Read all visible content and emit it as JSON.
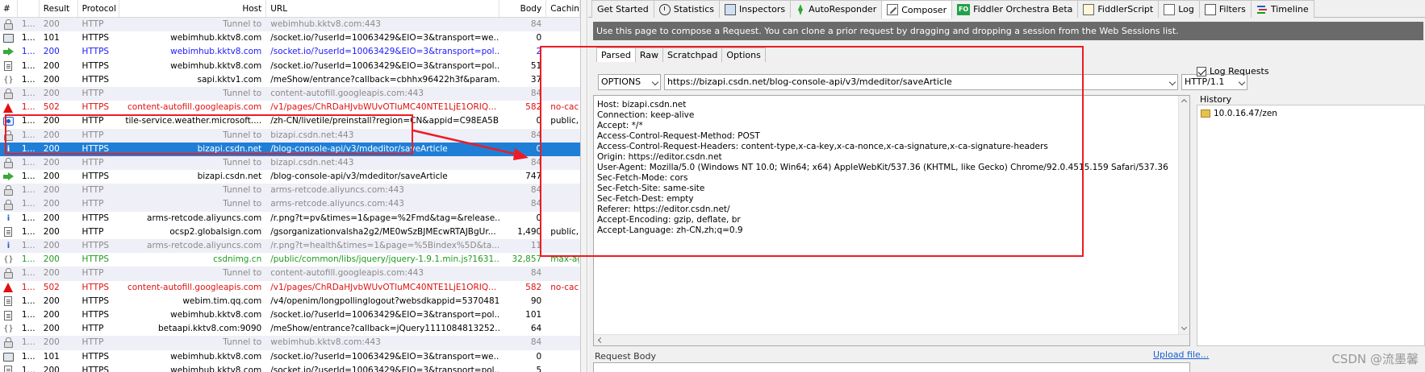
{
  "sessions": {
    "columns": [
      "#",
      "Result",
      "Protocol",
      "Host",
      "URL",
      "Body",
      "Caching"
    ],
    "rows": [
      {
        "icon": "lock",
        "style": "tunnel",
        "num": "1...",
        "result": "200",
        "protocol": "HTTP",
        "host": "Tunnel to",
        "url": "webimhub.kktv8.com:443",
        "body": "84",
        "caching": ""
      },
      {
        "icon": "socket",
        "style": "normal",
        "num": "1...",
        "result": "101",
        "protocol": "HTTPS",
        "host": "webimhub.kktv8.com",
        "url": "/socket.io/?userId=10063429&EIO=3&transport=we...",
        "body": "0",
        "caching": ""
      },
      {
        "icon": "arrow",
        "style": "blue",
        "num": "1...",
        "result": "200",
        "protocol": "HTTPS",
        "host": "webimhub.kktv8.com",
        "url": "/socket.io/?userId=10063429&EIO=3&transport=pol...",
        "body": "2",
        "caching": ""
      },
      {
        "icon": "doc",
        "style": "normal",
        "num": "1...",
        "result": "200",
        "protocol": "HTTPS",
        "host": "webimhub.kktv8.com",
        "url": "/socket.io/?userId=10063429&EIO=3&transport=pol...",
        "body": "51",
        "caching": ""
      },
      {
        "icon": "braces",
        "style": "normal",
        "num": "1...",
        "result": "200",
        "protocol": "HTTPS",
        "host": "sapi.kktv1.com",
        "url": "/meShow/entrance?callback=cbhhx96422h3f&param...",
        "body": "37",
        "caching": ""
      },
      {
        "icon": "lock",
        "style": "tunnel",
        "num": "1...",
        "result": "200",
        "protocol": "HTTP",
        "host": "Tunnel to",
        "url": "content-autofill.googleapis.com:443",
        "body": "84",
        "caching": ""
      },
      {
        "icon": "warn",
        "style": "red",
        "num": "1...",
        "result": "502",
        "protocol": "HTTPS",
        "host": "content-autofill.googleapis.com",
        "url": "/v1/pages/ChRDaHJvbWUvOTIuMC40NTE1LjE1ORIQ...",
        "body": "582",
        "caching": "no-cac..."
      },
      {
        "icon": "eye",
        "style": "normal",
        "num": "1...",
        "result": "200",
        "protocol": "HTTP",
        "host": "tile-service.weather.microsoft....",
        "url": "/zh-CN/livetile/preinstall?region=CN&appid=C98EA5B...",
        "body": "0",
        "caching": "public, ..."
      },
      {
        "icon": "lock",
        "style": "tunnel",
        "num": "1...",
        "result": "200",
        "protocol": "HTTP",
        "host": "Tunnel to",
        "url": "bizapi.csdn.net:443",
        "body": "84",
        "caching": ""
      },
      {
        "icon": "info",
        "style": "selected",
        "num": "1...",
        "result": "200",
        "protocol": "HTTPS",
        "host": "bizapi.csdn.net",
        "url": "/blog-console-api/v3/mdeditor/saveArticle",
        "body": "0",
        "caching": ""
      },
      {
        "icon": "lock",
        "style": "tunnel",
        "num": "1...",
        "result": "200",
        "protocol": "HTTP",
        "host": "Tunnel to",
        "url": "bizapi.csdn.net:443",
        "body": "84",
        "caching": ""
      },
      {
        "icon": "arrow",
        "style": "normal",
        "num": "1...",
        "result": "200",
        "protocol": "HTTPS",
        "host": "bizapi.csdn.net",
        "url": "/blog-console-api/v3/mdeditor/saveArticle",
        "body": "747",
        "caching": ""
      },
      {
        "icon": "lock",
        "style": "tunnel",
        "num": "1...",
        "result": "200",
        "protocol": "HTTP",
        "host": "Tunnel to",
        "url": "arms-retcode.aliyuncs.com:443",
        "body": "84",
        "caching": ""
      },
      {
        "icon": "lock",
        "style": "tunnel",
        "num": "1...",
        "result": "200",
        "protocol": "HTTP",
        "host": "Tunnel to",
        "url": "arms-retcode.aliyuncs.com:443",
        "body": "84",
        "caching": ""
      },
      {
        "icon": "info",
        "style": "normal",
        "num": "1...",
        "result": "200",
        "protocol": "HTTPS",
        "host": "arms-retcode.aliyuncs.com",
        "url": "/r.png?t=pv&times=1&page=%2Fmd&tag=&release...",
        "body": "0",
        "caching": ""
      },
      {
        "icon": "doc",
        "style": "normal",
        "num": "1...",
        "result": "200",
        "protocol": "HTTP",
        "host": "ocsp2.globalsign.com",
        "url": "/gsorganizationvalsha2g2/ME0wSzBJMEcwRTAJBgUr...",
        "body": "1,490",
        "caching": "public, ..."
      },
      {
        "icon": "info",
        "style": "tunnel",
        "num": "1...",
        "result": "200",
        "protocol": "HTTPS",
        "host": "arms-retcode.aliyuncs.com",
        "url": "/r.png?t=health&times=1&page=%5Bindex%5D&ta...",
        "body": "11",
        "caching": ""
      },
      {
        "icon": "braces",
        "style": "green",
        "num": "1...",
        "result": "200",
        "protocol": "HTTPS",
        "host": "csdnimg.cn",
        "url": "/public/common/libs/jquery/jquery-1.9.1.min.js?1631...",
        "body": "32,857",
        "caching": "max-ag..."
      },
      {
        "icon": "lock",
        "style": "tunnel",
        "num": "1...",
        "result": "200",
        "protocol": "HTTP",
        "host": "Tunnel to",
        "url": "content-autofill.googleapis.com:443",
        "body": "84",
        "caching": ""
      },
      {
        "icon": "warn",
        "style": "red",
        "num": "1...",
        "result": "502",
        "protocol": "HTTPS",
        "host": "content-autofill.googleapis.com",
        "url": "/v1/pages/ChRDaHJvbWUvOTIuMC40NTE1LjE1ORIQ...",
        "body": "582",
        "caching": "no-cac..."
      },
      {
        "icon": "doc",
        "style": "normal",
        "num": "1...",
        "result": "200",
        "protocol": "HTTPS",
        "host": "webim.tim.qq.com",
        "url": "/v4/openim/longpollinglogout?websdkappid=5370481...",
        "body": "90",
        "caching": ""
      },
      {
        "icon": "doc",
        "style": "normal",
        "num": "1...",
        "result": "200",
        "protocol": "HTTPS",
        "host": "webimhub.kktv8.com",
        "url": "/socket.io/?userId=10063429&EIO=3&transport=pol...",
        "body": "101",
        "caching": ""
      },
      {
        "icon": "braces",
        "style": "normal",
        "num": "1...",
        "result": "200",
        "protocol": "HTTP",
        "host": "betaapi.kktv8.com:9090",
        "url": "/meShow/entrance?callback=jQuery1111084813252...",
        "body": "64",
        "caching": ""
      },
      {
        "icon": "lock",
        "style": "tunnel",
        "num": "1...",
        "result": "200",
        "protocol": "HTTP",
        "host": "Tunnel to",
        "url": "webimhub.kktv8.com:443",
        "body": "84",
        "caching": ""
      },
      {
        "icon": "socket",
        "style": "normal",
        "num": "1...",
        "result": "101",
        "protocol": "HTTPS",
        "host": "webimhub.kktv8.com",
        "url": "/socket.io/?userId=10063429&EIO=3&transport=we...",
        "body": "0",
        "caching": ""
      },
      {
        "icon": "doc",
        "style": "normal",
        "num": "1...",
        "result": "200",
        "protocol": "HTTPS",
        "host": "webimhub.kktv8.com",
        "url": "/socket.io/?userId=10063429&EIO=3&transport=pol...",
        "body": "5",
        "caching": ""
      }
    ]
  },
  "tabs": [
    {
      "label": "Get Started",
      "icon": "none",
      "active": false
    },
    {
      "label": "Statistics",
      "icon": "clock",
      "active": false
    },
    {
      "label": "Inspectors",
      "icon": "inspect",
      "active": false
    },
    {
      "label": "AutoResponder",
      "icon": "bolt",
      "active": false
    },
    {
      "label": "Composer",
      "icon": "pen",
      "active": true
    },
    {
      "label": "Fiddler Orchestra Beta",
      "icon": "fo",
      "active": false
    },
    {
      "label": "FiddlerScript",
      "icon": "script",
      "active": false
    },
    {
      "label": "Log",
      "icon": "logi",
      "active": false
    },
    {
      "label": "Filters",
      "icon": "check",
      "active": false
    },
    {
      "label": "Timeline",
      "icon": "timeline",
      "active": false
    }
  ],
  "composer": {
    "banner": "Use this page to compose a Request. You can clone a prior request by dragging and dropping a session from the Web Sessions list.",
    "subtabs": [
      {
        "label": "Parsed",
        "active": true
      },
      {
        "label": "Raw",
        "active": false
      },
      {
        "label": "Scratchpad",
        "active": false
      },
      {
        "label": "Options",
        "active": false
      }
    ],
    "method": "OPTIONS",
    "url": "https://bizapi.csdn.net/blog-console-api/v3/mdeditor/saveArticle",
    "http_version": "HTTP/1.1",
    "headers": "Host: bizapi.csdn.net\nConnection: keep-alive\nAccept: */*\nAccess-Control-Request-Method: POST\nAccess-Control-Request-Headers: content-type,x-ca-key,x-ca-nonce,x-ca-signature,x-ca-signature-headers\nOrigin: https://editor.csdn.net\nUser-Agent: Mozilla/5.0 (Windows NT 10.0; Win64; x64) AppleWebKit/537.36 (KHTML, like Gecko) Chrome/92.0.4515.159 Safari/537.36\nSec-Fetch-Mode: cors\nSec-Fetch-Site: same-site\nSec-Fetch-Dest: empty\nReferer: https://editor.csdn.net/\nAccept-Encoding: gzip, deflate, br\nAccept-Language: zh-CN,zh;q=0.9",
    "request_body_label": "Request Body",
    "upload_link": "Upload file...",
    "log_requests_label": "Log Requests",
    "log_requests_checked": true,
    "history_label": "History",
    "history_items": [
      "10.0.16.47/zen"
    ]
  },
  "watermark": "CSDN @流墨馨",
  "colors": {
    "highlight": "#ee1b24",
    "selected_row": "#1f7fd6",
    "banner": "#6a6a6a"
  }
}
